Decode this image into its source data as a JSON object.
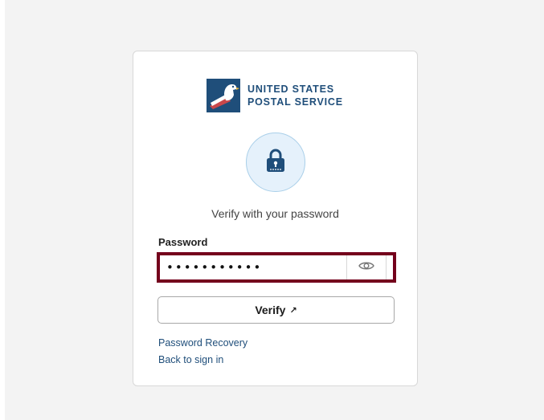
{
  "logo": {
    "line1": "UNITED STATES",
    "line2": "POSTAL SERVICE",
    "icon": "eagle-logo-icon",
    "color": "#1f4e7a"
  },
  "lock": {
    "icon": "lock-icon",
    "background": "#e5f1fb"
  },
  "subtitle": "Verify with your password",
  "password": {
    "label": "Password",
    "value": "•••••••••••",
    "reveal_icon": "eye-icon",
    "focus_border_color": "#74001c"
  },
  "verify_button": {
    "label": "Verify",
    "icon": "arrow-up-right-icon"
  },
  "links": {
    "recovery": "Password Recovery",
    "back": "Back to sign in"
  }
}
